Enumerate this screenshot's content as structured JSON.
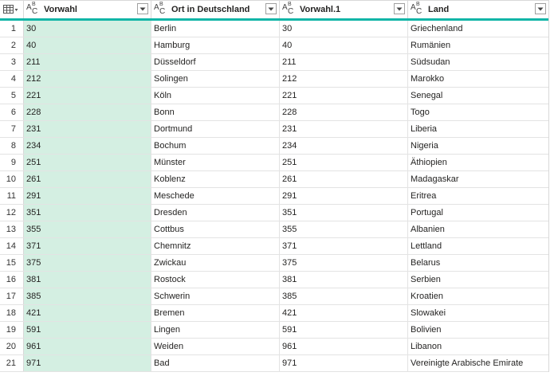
{
  "columns": [
    {
      "label": "Vorwahl",
      "type_icon": "text-type-icon"
    },
    {
      "label": "Ort in Deutschland",
      "type_icon": "text-type-icon"
    },
    {
      "label": "Vorwahl.1",
      "type_icon": "text-type-icon"
    },
    {
      "label": "Land",
      "type_icon": "text-type-icon"
    }
  ],
  "type_glyph": {
    "a": "A",
    "b": "B",
    "c": "C"
  },
  "colors": {
    "accent": "#11b5a7",
    "selected_column": "#d4efe2"
  },
  "rows": [
    {
      "n": "1",
      "vorwahl": "30",
      "ort": "Berlin",
      "vorwahl1": "30",
      "land": "Griechenland"
    },
    {
      "n": "2",
      "vorwahl": "40",
      "ort": "Hamburg",
      "vorwahl1": "40",
      "land": "Rumänien"
    },
    {
      "n": "3",
      "vorwahl": "211",
      "ort": "Düsseldorf",
      "vorwahl1": "211",
      "land": "Südsudan"
    },
    {
      "n": "4",
      "vorwahl": "212",
      "ort": "Solingen",
      "vorwahl1": "212",
      "land": "Marokko"
    },
    {
      "n": "5",
      "vorwahl": "221",
      "ort": "Köln",
      "vorwahl1": "221",
      "land": "Senegal"
    },
    {
      "n": "6",
      "vorwahl": "228",
      "ort": "Bonn",
      "vorwahl1": "228",
      "land": "Togo"
    },
    {
      "n": "7",
      "vorwahl": "231",
      "ort": "Dortmund",
      "vorwahl1": "231",
      "land": "Liberia"
    },
    {
      "n": "8",
      "vorwahl": "234",
      "ort": "Bochum",
      "vorwahl1": "234",
      "land": "Nigeria"
    },
    {
      "n": "9",
      "vorwahl": "251",
      "ort": "Münster",
      "vorwahl1": "251",
      "land": "Äthiopien"
    },
    {
      "n": "10",
      "vorwahl": "261",
      "ort": "Koblenz",
      "vorwahl1": "261",
      "land": "Madagaskar"
    },
    {
      "n": "11",
      "vorwahl": "291",
      "ort": "Meschede",
      "vorwahl1": "291",
      "land": "Eritrea"
    },
    {
      "n": "12",
      "vorwahl": "351",
      "ort": "Dresden",
      "vorwahl1": "351",
      "land": "Portugal"
    },
    {
      "n": "13",
      "vorwahl": "355",
      "ort": "Cottbus",
      "vorwahl1": "355",
      "land": "Albanien"
    },
    {
      "n": "14",
      "vorwahl": "371",
      "ort": "Chemnitz",
      "vorwahl1": "371",
      "land": "Lettland"
    },
    {
      "n": "15",
      "vorwahl": "375",
      "ort": "Zwickau",
      "vorwahl1": "375",
      "land": "Belarus"
    },
    {
      "n": "16",
      "vorwahl": "381",
      "ort": "Rostock",
      "vorwahl1": "381",
      "land": "Serbien"
    },
    {
      "n": "17",
      "vorwahl": "385",
      "ort": "Schwerin",
      "vorwahl1": "385",
      "land": "Kroatien"
    },
    {
      "n": "18",
      "vorwahl": "421",
      "ort": "Bremen",
      "vorwahl1": "421",
      "land": "Slowakei"
    },
    {
      "n": "19",
      "vorwahl": "591",
      "ort": "Lingen",
      "vorwahl1": "591",
      "land": "Bolivien"
    },
    {
      "n": "20",
      "vorwahl": "961",
      "ort": "Weiden",
      "vorwahl1": "961",
      "land": "Libanon"
    },
    {
      "n": "21",
      "vorwahl": "971",
      "ort": "Bad",
      "vorwahl1": "971",
      "land": "Vereinigte Arabische Emirate"
    }
  ]
}
